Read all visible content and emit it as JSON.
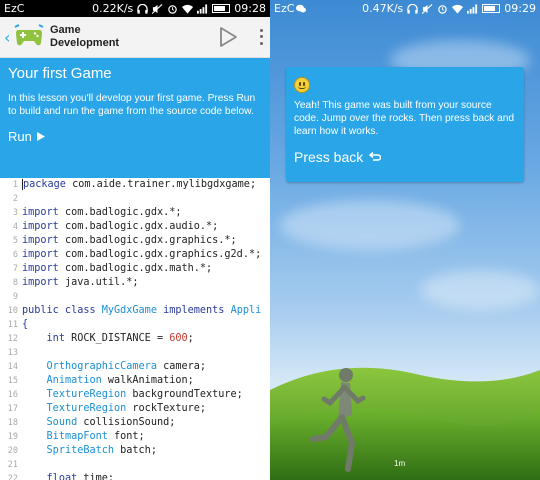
{
  "left": {
    "status": {
      "carrier": "EzC",
      "speed": "0.22K/s",
      "time": "09:28"
    },
    "appbar": {
      "title_line1": "Game",
      "title_line2": "Development"
    },
    "lesson": {
      "title": "Your first Game",
      "body": "In this lesson you'll develop your first game. Press Run to build and run the game from the source code below.",
      "run_label": "Run"
    },
    "code_lines": [
      {
        "n": "1",
        "html": "<span class='caret'></span><span class='kw'>package</span> com.aide.trainer.mylibgdxgame;"
      },
      {
        "n": "2",
        "html": ""
      },
      {
        "n": "3",
        "html": "<span class='kw'>import</span> com.badlogic.gdx.*;"
      },
      {
        "n": "4",
        "html": "<span class='kw'>import</span> com.badlogic.gdx.audio.*;"
      },
      {
        "n": "5",
        "html": "<span class='kw'>import</span> com.badlogic.gdx.graphics.*;"
      },
      {
        "n": "6",
        "html": "<span class='kw'>import</span> com.badlogic.gdx.graphics.g2d.*;"
      },
      {
        "n": "7",
        "html": "<span class='kw'>import</span> com.badlogic.gdx.math.*;"
      },
      {
        "n": "8",
        "html": "<span class='kw'>import</span> java.util.*;"
      },
      {
        "n": "9",
        "html": ""
      },
      {
        "n": "10",
        "html": "<span class='kw'>public class</span> <span class='ty'>MyGdxGame</span> <span class='kw'>implements</span> <span class='ty'>Appli</span>"
      },
      {
        "n": "11",
        "html": "<span class='kw'>{</span>"
      },
      {
        "n": "12",
        "html": "    <span class='kw'>int</span> ROCK_DISTANCE = <span class='num'>600</span>;"
      },
      {
        "n": "13",
        "html": ""
      },
      {
        "n": "14",
        "html": "    <span class='ty'>OrthographicCamera</span> camera;"
      },
      {
        "n": "15",
        "html": "    <span class='ty'>Animation</span> walkAnimation;"
      },
      {
        "n": "16",
        "html": "    <span class='ty'>TextureRegion</span> backgroundTexture;"
      },
      {
        "n": "17",
        "html": "    <span class='ty'>TextureRegion</span> rockTexture;"
      },
      {
        "n": "18",
        "html": "    <span class='ty'>Sound</span> collisionSound;"
      },
      {
        "n": "19",
        "html": "    <span class='ty'>BitmapFont</span> font;"
      },
      {
        "n": "20",
        "html": "    <span class='ty'>SpriteBatch</span> batch;"
      },
      {
        "n": "21",
        "html": ""
      },
      {
        "n": "22",
        "html": "    <span class='kw'>float</span> time;"
      }
    ]
  },
  "right": {
    "status": {
      "carrier": "EzC",
      "speed": "0.47K/s",
      "time": "09:29"
    },
    "toast": {
      "message": "Yeah! This game was built from your source code. Jump over the rocks. Then press back and learn how it works.",
      "back_label": "Press back"
    },
    "distance": "1m"
  }
}
